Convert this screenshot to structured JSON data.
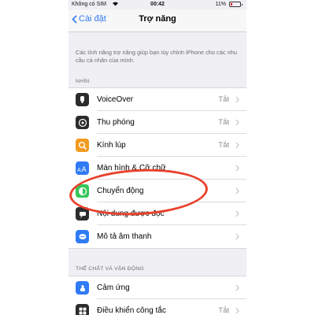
{
  "status_bar": {
    "carrier": "Không có SIM",
    "time": "00:42",
    "battery": "11%"
  },
  "nav": {
    "back_label": "Cài đặt",
    "title": "Trợ năng"
  },
  "description": "Các tính năng trợ năng giúp bạn tùy chỉnh iPhone cho các nhu cầu cá nhân của mình.",
  "sections": [
    {
      "header": "NHÌN",
      "rows": [
        {
          "label": "VoiceOver",
          "value": "Tắt",
          "icon": "voiceover-icon",
          "color": "#2c2c2e"
        },
        {
          "label": "Thu phóng",
          "value": "Tắt",
          "icon": "zoom-icon",
          "color": "#2c2c2e"
        },
        {
          "label": "Kính lúp",
          "value": "Tắt",
          "icon": "magnifier-icon",
          "color": "#f29b1d"
        },
        {
          "label": "Màn hình & Cỡ chữ",
          "value": "",
          "icon": "text-size-icon",
          "color": "#2f7bf5"
        },
        {
          "label": "Chuyển động",
          "value": "",
          "icon": "motion-icon",
          "color": "#34c759"
        },
        {
          "label": "Nội dung được đọc",
          "value": "",
          "icon": "speech-icon",
          "color": "#2c2c2e"
        },
        {
          "label": "Mô tả âm thanh",
          "value": "",
          "icon": "audio-description-icon",
          "color": "#2f7bf5"
        }
      ]
    },
    {
      "header": "THỂ CHẤT VÀ VẬN ĐỘNG",
      "rows": [
        {
          "label": "Cảm ứng",
          "value": "",
          "icon": "touch-icon",
          "color": "#2f7bf5"
        },
        {
          "label": "Điều khiển công tắc",
          "value": "Tắt",
          "icon": "switch-control-icon",
          "color": "#2c2c2e"
        }
      ]
    }
  ],
  "colors": {
    "accent": "#2f7bf5",
    "annotation": "#e8412c"
  }
}
